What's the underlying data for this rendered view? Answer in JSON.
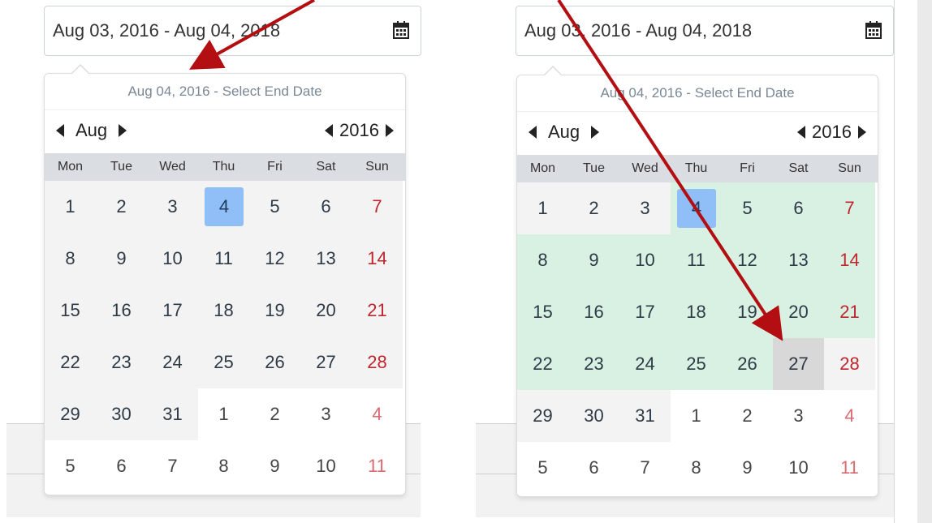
{
  "left": {
    "input": {
      "value": "Aug 03, 2016 - Aug 04, 2018"
    },
    "popup": {
      "header": "Aug 04, 2016 - Select End Date",
      "month": "Aug",
      "year": "2016",
      "weekdays": [
        "Mon",
        "Tue",
        "Wed",
        "Thu",
        "Fri",
        "Sat",
        "Sun"
      ],
      "selected": "4",
      "days": [
        [
          "1",
          "2",
          "3",
          "4",
          "5",
          "6",
          "7"
        ],
        [
          "8",
          "9",
          "10",
          "11",
          "12",
          "13",
          "14"
        ],
        [
          "15",
          "16",
          "17",
          "18",
          "19",
          "20",
          "21"
        ],
        [
          "22",
          "23",
          "24",
          "25",
          "26",
          "27",
          "28"
        ],
        [
          "29",
          "30",
          "31",
          "1",
          "2",
          "3",
          "4"
        ],
        [
          "5",
          "6",
          "7",
          "8",
          "9",
          "10",
          "11"
        ]
      ]
    }
  },
  "right": {
    "input": {
      "value": "Aug 03, 2016 - Aug 04, 2018"
    },
    "popup": {
      "header": "Aug 04, 2016 - Select End Date",
      "month": "Aug",
      "year": "2016",
      "weekdays": [
        "Mon",
        "Tue",
        "Wed",
        "Thu",
        "Fri",
        "Sat",
        "Sun"
      ],
      "selected": "4",
      "hover_end": "27",
      "days": [
        [
          "1",
          "2",
          "3",
          "4",
          "5",
          "6",
          "7"
        ],
        [
          "8",
          "9",
          "10",
          "11",
          "12",
          "13",
          "14"
        ],
        [
          "15",
          "16",
          "17",
          "18",
          "19",
          "20",
          "21"
        ],
        [
          "22",
          "23",
          "24",
          "25",
          "26",
          "27",
          "28"
        ],
        [
          "29",
          "30",
          "31",
          "1",
          "2",
          "3",
          "4"
        ],
        [
          "5",
          "6",
          "7",
          "8",
          "9",
          "10",
          "11"
        ]
      ]
    }
  },
  "colors": {
    "selected": "#8fbff6",
    "range": "#d8f1e3",
    "hover_end": "#d8d8d8",
    "weekend": "#c0262e",
    "arrow": "#b30f12"
  }
}
